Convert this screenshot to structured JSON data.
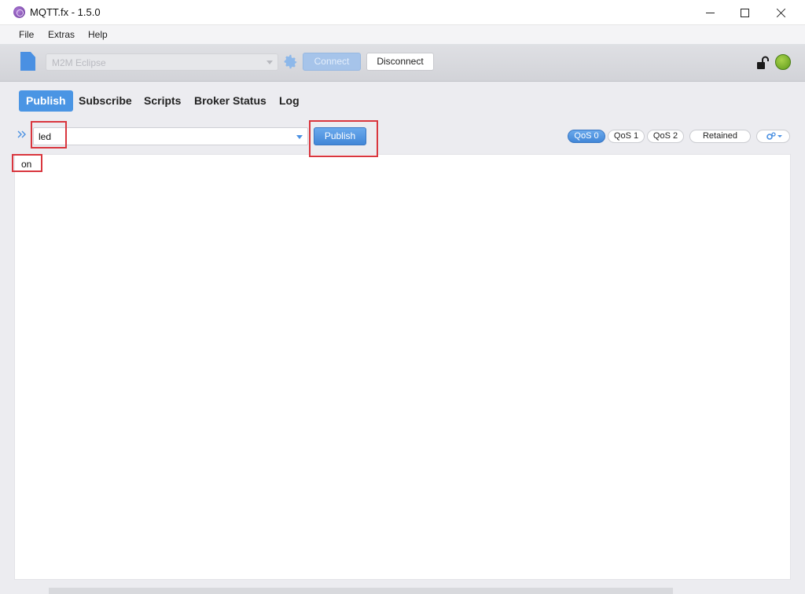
{
  "window": {
    "title": "MQTT.fx - 1.5.0"
  },
  "menu": {
    "items": [
      "File",
      "Extras",
      "Help"
    ]
  },
  "toolbar": {
    "profile_value": "M2M Eclipse",
    "connect_label": "Connect",
    "disconnect_label": "Disconnect"
  },
  "tabs": [
    "Publish",
    "Subscribe",
    "Scripts",
    "Broker Status",
    "Log"
  ],
  "publish": {
    "topic_value": "led",
    "publish_label": "Publish",
    "qos": [
      "QoS 0",
      "QoS 1",
      "QoS 2"
    ],
    "retained_label": "Retained",
    "payload_value": "on"
  },
  "colors": {
    "accent": "#4a95e4",
    "highlight": "#d9363e",
    "status_connected": "#6fae23"
  },
  "icons": {
    "app": "mqtt-fx-icon",
    "new_profile": "file-icon",
    "settings": "gear-icon",
    "lock": "unlock-icon",
    "status": "connection-status-icon",
    "expand": "double-chevron-right-icon",
    "options": "gears-dropdown-icon"
  }
}
